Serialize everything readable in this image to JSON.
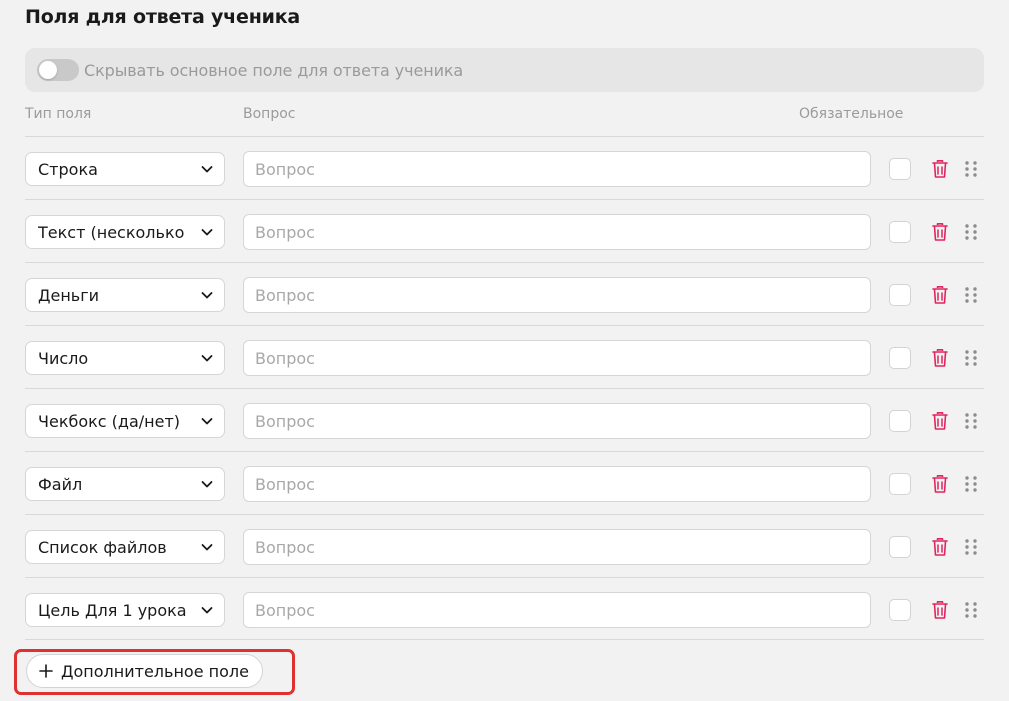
{
  "section": {
    "title": "Поля для ответа ученика"
  },
  "hide_main_field": {
    "label": "Скрывать основное поле для ответа ученика",
    "enabled": false
  },
  "columns": {
    "type": "Тип поля",
    "question": "Вопрос",
    "required": "Обязательное"
  },
  "rows": [
    {
      "type": "Строка",
      "question": "",
      "placeholder": "Вопрос",
      "required": false
    },
    {
      "type": "Текст (несколько",
      "question": "",
      "placeholder": "Вопрос",
      "required": false
    },
    {
      "type": "Деньги",
      "question": "",
      "placeholder": "Вопрос",
      "required": false
    },
    {
      "type": "Число",
      "question": "",
      "placeholder": "Вопрос",
      "required": false
    },
    {
      "type": "Чекбокс (да/нет)",
      "question": "",
      "placeholder": "Вопрос",
      "required": false
    },
    {
      "type": "Файл",
      "question": "",
      "placeholder": "Вопрос",
      "required": false
    },
    {
      "type": "Список файлов",
      "question": "",
      "placeholder": "Вопрос",
      "required": false
    },
    {
      "type": "Цель Для 1 урока",
      "question": "",
      "placeholder": "Вопрос",
      "required": false
    }
  ],
  "add_field": {
    "label": "Дополнительное поле"
  },
  "icons": {
    "select": "chevron-down-icon",
    "delete": "trash-icon",
    "reorder": "drag-handle-icon",
    "add": "plus-icon"
  },
  "colors": {
    "delete": "#e0245e",
    "highlight": "#e03131",
    "toggle_off": "#c9c9c9"
  }
}
